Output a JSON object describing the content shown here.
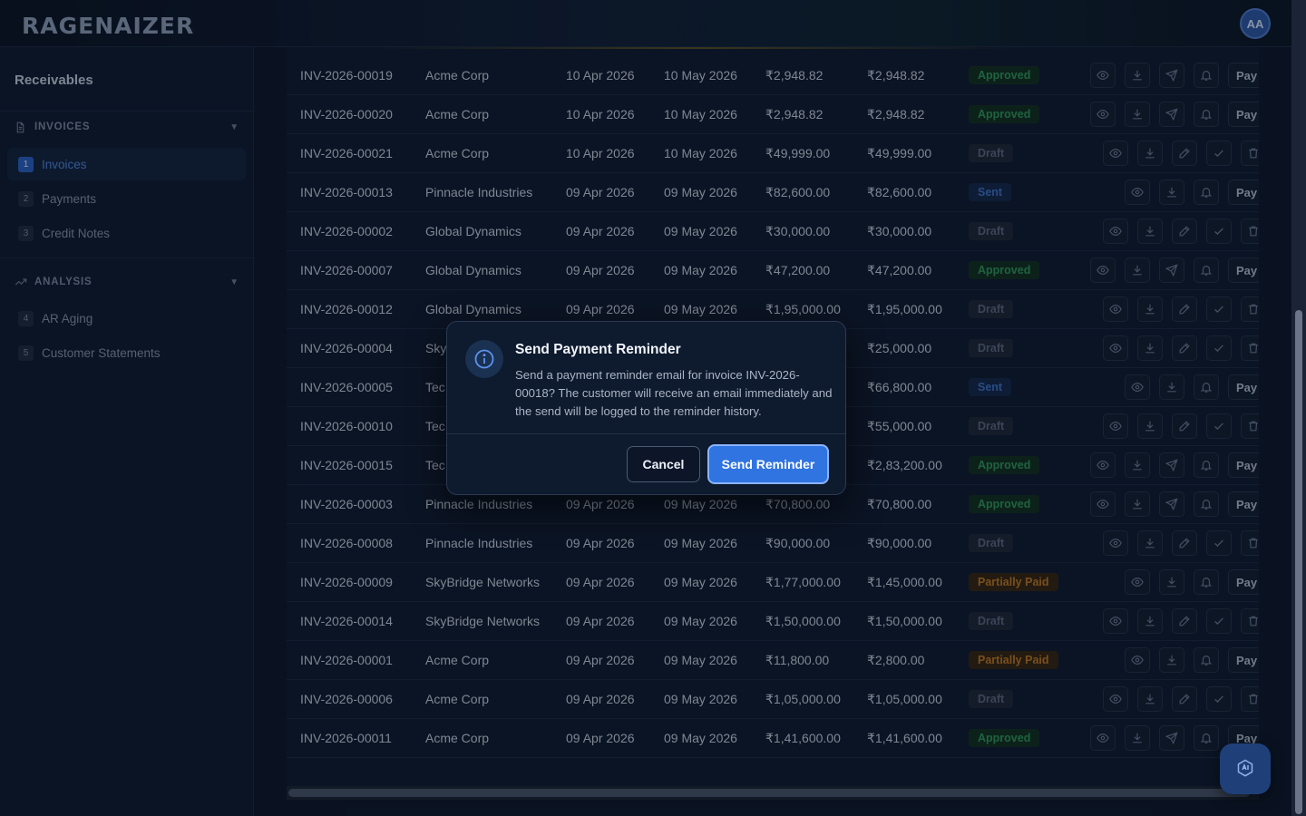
{
  "brand": {
    "logo_text": "RAGENAIZER",
    "avatar_initials": "AA"
  },
  "sidebar": {
    "title": "Receivables",
    "sections": [
      {
        "label": "INVOICES",
        "icon": "document-icon",
        "items": [
          {
            "num": "1",
            "label": "Invoices",
            "active": true
          },
          {
            "num": "2",
            "label": "Payments",
            "active": false
          },
          {
            "num": "3",
            "label": "Credit Notes",
            "active": false
          }
        ]
      },
      {
        "label": "ANALYSIS",
        "icon": "trend-icon",
        "items": [
          {
            "num": "4",
            "label": "AR Aging",
            "active": false
          },
          {
            "num": "5",
            "label": "Customer Statements",
            "active": false
          }
        ]
      }
    ]
  },
  "invoices": {
    "pay_label": "Pay",
    "rows": [
      {
        "invoice": "INV-2026-00019",
        "customer": "Acme Corp",
        "date": "10 Apr 2026",
        "due": "10 May 2026",
        "amount": "₹2,948.82",
        "balance": "₹2,948.82",
        "status": "Approved"
      },
      {
        "invoice": "INV-2026-00020",
        "customer": "Acme Corp",
        "date": "10 Apr 2026",
        "due": "10 May 2026",
        "amount": "₹2,948.82",
        "balance": "₹2,948.82",
        "status": "Approved"
      },
      {
        "invoice": "INV-2026-00021",
        "customer": "Acme Corp",
        "date": "10 Apr 2026",
        "due": "10 May 2026",
        "amount": "₹49,999.00",
        "balance": "₹49,999.00",
        "status": "Draft"
      },
      {
        "invoice": "INV-2026-00013",
        "customer": "Pinnacle Industries",
        "date": "09 Apr 2026",
        "due": "09 May 2026",
        "amount": "₹82,600.00",
        "balance": "₹82,600.00",
        "status": "Sent"
      },
      {
        "invoice": "INV-2026-00002",
        "customer": "Global Dynamics",
        "date": "09 Apr 2026",
        "due": "09 May 2026",
        "amount": "₹30,000.00",
        "balance": "₹30,000.00",
        "status": "Draft"
      },
      {
        "invoice": "INV-2026-00007",
        "customer": "Global Dynamics",
        "date": "09 Apr 2026",
        "due": "09 May 2026",
        "amount": "₹47,200.00",
        "balance": "₹47,200.00",
        "status": "Approved"
      },
      {
        "invoice": "INV-2026-00012",
        "customer": "Global Dynamics",
        "date": "09 Apr 2026",
        "due": "09 May 2026",
        "amount": "₹1,95,000.00",
        "balance": "₹1,95,000.00",
        "status": "Draft"
      },
      {
        "invoice": "INV-2026-00004",
        "customer": "Sky",
        "date": "",
        "due": "",
        "amount": "",
        "balance": "₹25,000.00",
        "status": "Draft"
      },
      {
        "invoice": "INV-2026-00005",
        "customer": "Tec",
        "date": "",
        "due": "",
        "amount": "",
        "balance": "₹66,800.00",
        "status": "Sent"
      },
      {
        "invoice": "INV-2026-00010",
        "customer": "Tec",
        "date": "",
        "due": "",
        "amount": "",
        "balance": "₹55,000.00",
        "status": "Draft"
      },
      {
        "invoice": "INV-2026-00015",
        "customer": "Tec",
        "date": "",
        "due": "",
        "amount": "",
        "balance": "₹2,83,200.00",
        "status": "Approved"
      },
      {
        "invoice": "INV-2026-00003",
        "customer": "Pinnacle Industries",
        "date": "09 Apr 2026",
        "due": "09 May 2026",
        "amount": "₹70,800.00",
        "balance": "₹70,800.00",
        "status": "Approved"
      },
      {
        "invoice": "INV-2026-00008",
        "customer": "Pinnacle Industries",
        "date": "09 Apr 2026",
        "due": "09 May 2026",
        "amount": "₹90,000.00",
        "balance": "₹90,000.00",
        "status": "Draft"
      },
      {
        "invoice": "INV-2026-00009",
        "customer": "SkyBridge Networks",
        "date": "09 Apr 2026",
        "due": "09 May 2026",
        "amount": "₹1,77,000.00",
        "balance": "₹1,45,000.00",
        "status": "Partially Paid"
      },
      {
        "invoice": "INV-2026-00014",
        "customer": "SkyBridge Networks",
        "date": "09 Apr 2026",
        "due": "09 May 2026",
        "amount": "₹1,50,000.00",
        "balance": "₹1,50,000.00",
        "status": "Draft"
      },
      {
        "invoice": "INV-2026-00001",
        "customer": "Acme Corp",
        "date": "09 Apr 2026",
        "due": "09 May 2026",
        "amount": "₹11,800.00",
        "balance": "₹2,800.00",
        "status": "Partially Paid"
      },
      {
        "invoice": "INV-2026-00006",
        "customer": "Acme Corp",
        "date": "09 Apr 2026",
        "due": "09 May 2026",
        "amount": "₹1,05,000.00",
        "balance": "₹1,05,000.00",
        "status": "Draft"
      },
      {
        "invoice": "INV-2026-00011",
        "customer": "Acme Corp",
        "date": "09 Apr 2026",
        "due": "09 May 2026",
        "amount": "₹1,41,600.00",
        "balance": "₹1,41,600.00",
        "status": "Approved"
      }
    ]
  },
  "modal": {
    "icon": "info-icon",
    "title": "Send Payment Reminder",
    "body": "Send a payment reminder email for invoice INV-2026-00018? The customer will receive an email immediately and the send will be logged to the reminder history.",
    "cancel_label": "Cancel",
    "confirm_label": "Send Reminder"
  },
  "colors": {
    "accent": "#2f74e0",
    "approved": "#2f9a57",
    "draft": "#5d6a7e",
    "sent": "#3f74c9",
    "partially_paid": "#c27a22"
  }
}
